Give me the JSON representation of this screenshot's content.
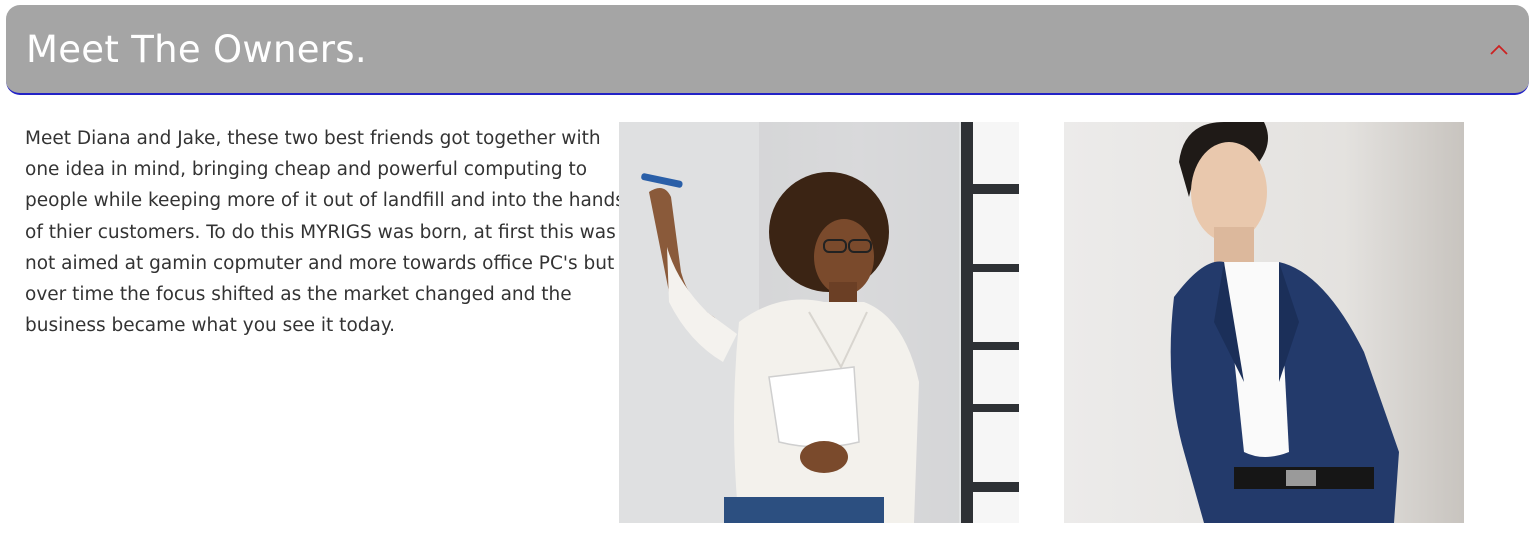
{
  "accordion": {
    "title": "Meet The Owners.",
    "toggle_icon": "chevron-up-icon",
    "toggle_color": "#cc2222",
    "header_bg": "#a5a5a5",
    "underline_color": "#2323c6"
  },
  "about": {
    "text": "Meet Diana and Jake, these two best friends got together with one idea in mind, bringing cheap and powerful computing to people while keeping more of it out of landfill and into the hands of thier customers. To do this MYRIGS was born, at first this was not aimed at gamin copmuter and more towards office PC's but over time the focus shifted as the market changed and the business became what you see it today."
  },
  "photos": [
    {
      "subject": "woman-writing-on-whiteboard"
    },
    {
      "subject": "man-in-navy-suit"
    }
  ]
}
